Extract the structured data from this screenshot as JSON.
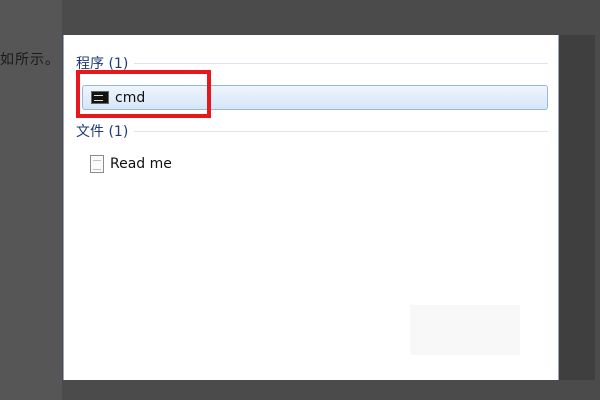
{
  "background": {
    "partial_text": "如所示。"
  },
  "start_menu": {
    "programs_header": "程序 (1)",
    "programs": [
      {
        "label": "cmd",
        "icon": "command-prompt-icon",
        "selected": true
      }
    ],
    "files_header": "文件 (1)",
    "files": [
      {
        "label": "Read me",
        "icon": "text-document-icon"
      }
    ]
  },
  "annotation": {
    "highlight_color": "#e8171b"
  }
}
